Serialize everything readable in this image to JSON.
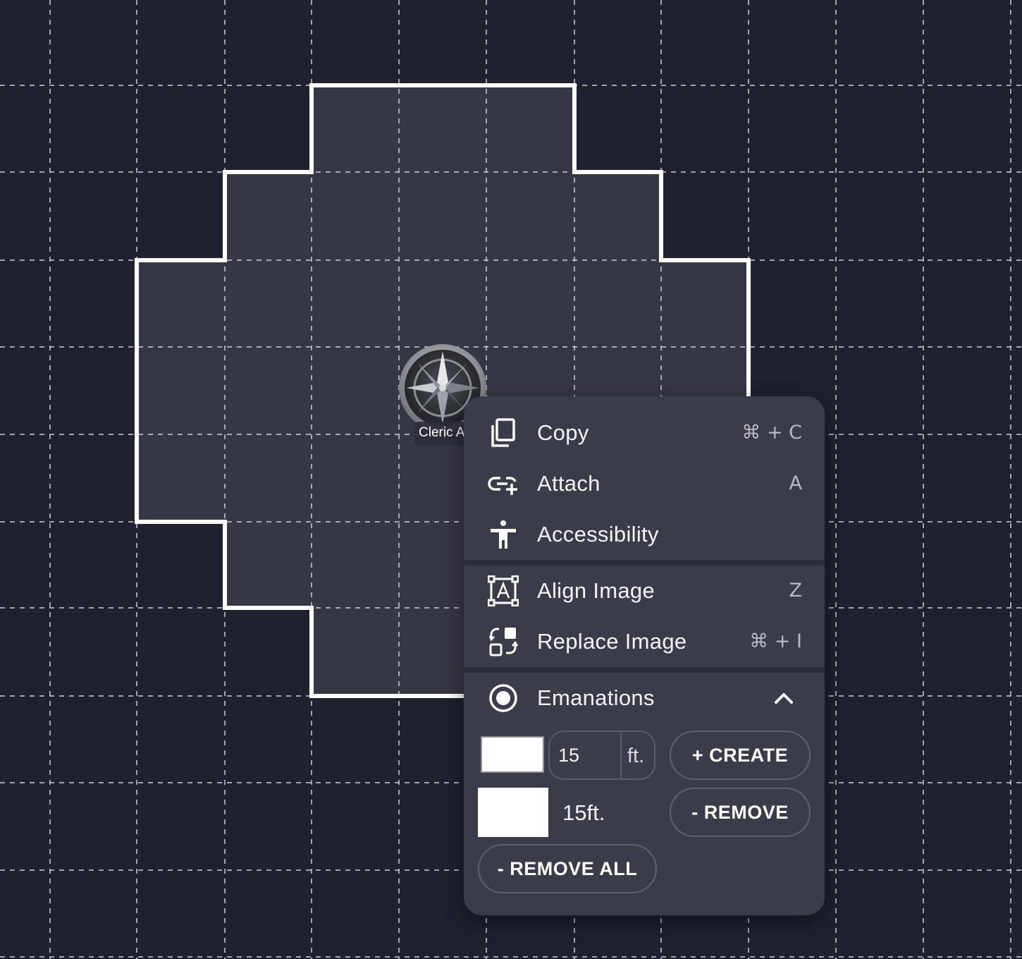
{
  "token": {
    "label": "Cleric A"
  },
  "menu": {
    "items": [
      {
        "label": "Copy",
        "shortcut": "⌘ + C",
        "icon": "copy-icon"
      },
      {
        "label": "Attach",
        "shortcut": "A",
        "icon": "attach-icon"
      },
      {
        "label": "Accessibility",
        "shortcut": "",
        "icon": "accessibility-icon"
      },
      {
        "label": "Align Image",
        "shortcut": "Z",
        "icon": "align-image-icon"
      },
      {
        "label": "Replace Image",
        "shortcut": "⌘ + I",
        "icon": "replace-image-icon"
      }
    ],
    "emanations": {
      "label": "Emanations",
      "icon": "radio-target-icon",
      "expanded": true,
      "new_emanation": {
        "color": "#ffffff",
        "distance": "15",
        "unit": "ft."
      },
      "create_label": "+ CREATE",
      "remove_label": "- REMOVE",
      "remove_all_label": "- REMOVE ALL",
      "existing": [
        {
          "color": "#ffffff",
          "size": "15ft."
        }
      ]
    }
  },
  "colors": {
    "background": "#1f2130",
    "area_fill": "#363744",
    "area_outline": "#ffffff",
    "grid": "#cfd0d8",
    "menu_bg": "#3a3c4a"
  }
}
